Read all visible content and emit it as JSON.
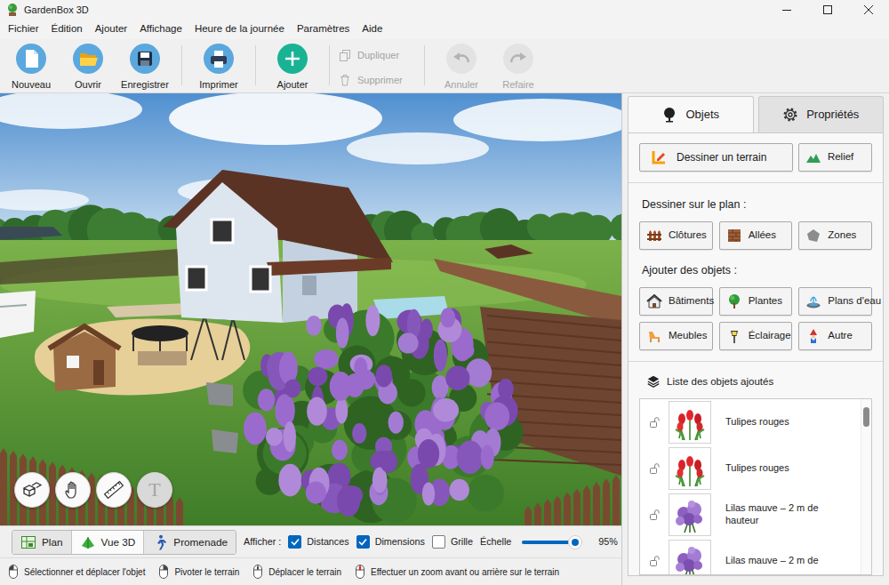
{
  "window": {
    "title": "GardenBox 3D"
  },
  "menu": [
    "Fichier",
    "Édition",
    "Ajouter",
    "Affichage",
    "Heure de la journée",
    "Paramètres",
    "Aide"
  ],
  "toolbar": [
    [
      {
        "label": "Nouveau",
        "kind": "large",
        "disabled": false
      },
      {
        "label": "Ouvrir",
        "kind": "large",
        "disabled": false
      },
      {
        "label": "Enregistrer",
        "kind": "large",
        "disabled": false
      }
    ],
    [
      {
        "label": "Imprimer",
        "kind": "large",
        "disabled": false
      }
    ],
    [
      {
        "label": "Ajouter",
        "kind": "large",
        "disabled": false
      }
    ],
    [
      {
        "label": "Dupliquer",
        "kind": "small",
        "disabled": true
      },
      {
        "label": "Supprimer",
        "kind": "small",
        "disabled": true
      }
    ],
    [
      {
        "label": "Annuler",
        "kind": "large",
        "disabled": true
      },
      {
        "label": "Refaire",
        "kind": "large",
        "disabled": true
      }
    ]
  ],
  "view_tools": [
    {
      "kind": "objects",
      "disabled": false
    },
    {
      "kind": "pan",
      "disabled": false
    },
    {
      "kind": "measure",
      "disabled": false
    },
    {
      "kind": "text",
      "label": "T",
      "disabled": true
    }
  ],
  "side_tabs": [
    {
      "label": "Objets",
      "selected": true
    },
    {
      "label": "Propriétés",
      "selected": false
    }
  ],
  "terrain_buttons": [
    "Dessiner un terrain",
    "Relief"
  ],
  "draw_section": {
    "title": "Dessiner sur le plan :",
    "buttons": [
      "Clôtures",
      "Allées",
      "Zones"
    ]
  },
  "add_section": {
    "title": "Ajouter des objets :",
    "buttons": [
      "Bâtiments",
      "Plantes",
      "Plans d'eau",
      "Meubles",
      "Éclairage",
      "Autre"
    ]
  },
  "object_list": {
    "title": "Liste des objets ajoutés",
    "scroll": {
      "level": 0.02
    },
    "items": [
      {
        "name": "Tulipes rouges",
        "kind": "tulip"
      },
      {
        "name": "Tulipes rouges",
        "kind": "tulip"
      },
      {
        "name": "Lilas mauve – 2 m de hauteur",
        "kind": "lilac"
      },
      {
        "name": "Lilas mauve – 2 m de",
        "kind": "lilac"
      }
    ]
  },
  "view_modes": [
    {
      "label": "Plan",
      "selected": false
    },
    {
      "label": "Vue 3D",
      "selected": true
    },
    {
      "label": "Promenade",
      "selected": false
    }
  ],
  "display": {
    "label": "Afficher :",
    "options": [
      {
        "label": "Distances",
        "checked": true
      },
      {
        "label": "Dimensions",
        "checked": true
      },
      {
        "label": "Grille",
        "checked": false
      }
    ],
    "scale": {
      "label": "Échelle",
      "level": 0.88,
      "reading": "95%"
    }
  },
  "status_bar": [
    {
      "label": "Sélectionner et déplacer l'objet",
      "kind": "left"
    },
    {
      "label": "Pivoter le terrain",
      "kind": "right"
    },
    {
      "label": "Déplacer le terrain",
      "kind": "middle"
    },
    {
      "label": "Effectuer un zoom avant ou arrière sur le terrain",
      "kind": "wheel"
    }
  ]
}
